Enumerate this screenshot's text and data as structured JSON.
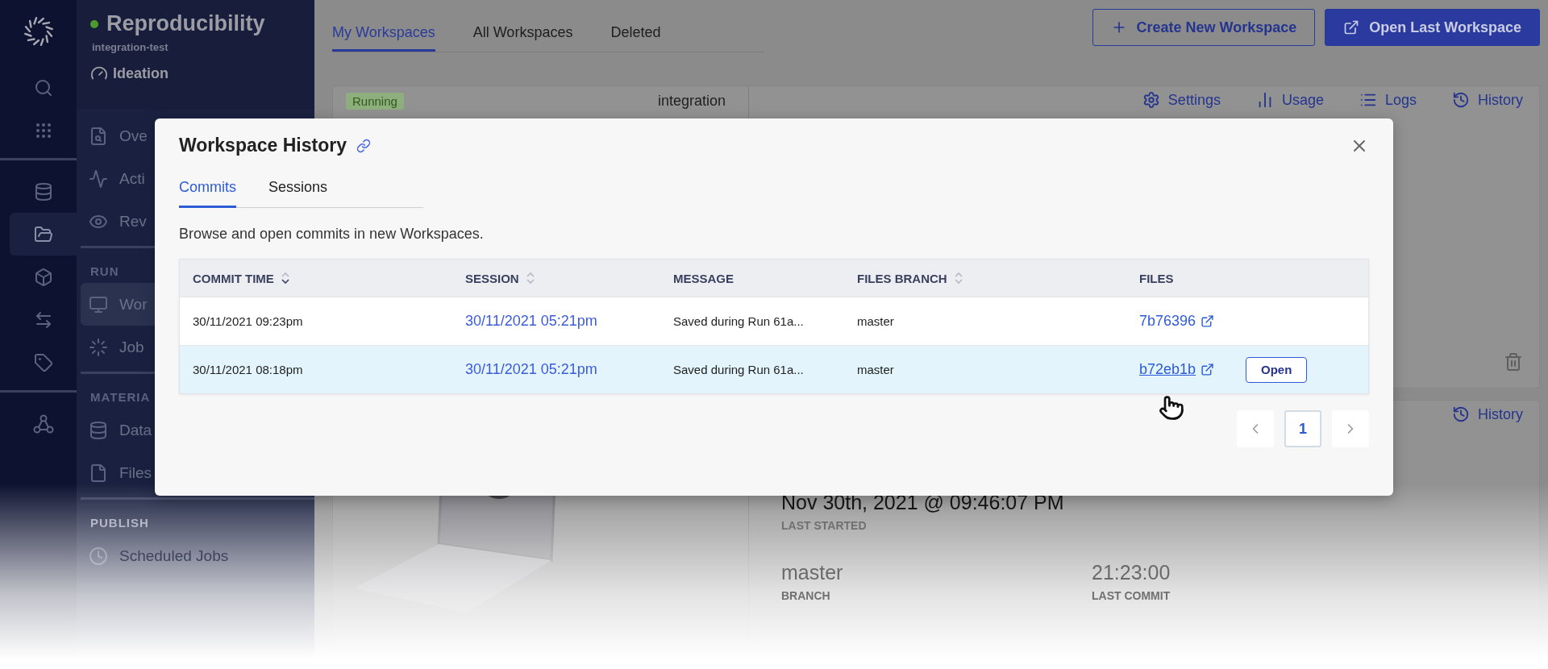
{
  "rail": {
    "groups": [
      [
        {
          "kind": "search",
          "selected": false
        },
        {
          "kind": "apps",
          "selected": false
        }
      ],
      [
        {
          "kind": "data",
          "selected": false
        },
        {
          "kind": "folder",
          "selected": true
        },
        {
          "kind": "cube",
          "selected": false
        },
        {
          "kind": "transfer",
          "selected": false
        },
        {
          "kind": "tag",
          "selected": false
        }
      ],
      [
        {
          "kind": "network",
          "selected": false
        }
      ]
    ]
  },
  "project": {
    "name": "Reproducibility",
    "owner": "integration-test",
    "stage": "Ideation"
  },
  "nav": {
    "sections": [
      {
        "items": [
          {
            "kind": "overview",
            "label": "Ove",
            "selected": false
          },
          {
            "kind": "activity",
            "label": "Acti",
            "selected": false
          },
          {
            "kind": "review",
            "label": "Rev",
            "selected": false
          }
        ]
      },
      {
        "heading": "RUN",
        "items": [
          {
            "kind": "workspaces",
            "label": "Wor",
            "selected": true
          },
          {
            "kind": "jobs",
            "label": "Job",
            "selected": false
          }
        ]
      },
      {
        "heading": "MATERIA",
        "items": [
          {
            "kind": "data",
            "label": "Data",
            "selected": false
          },
          {
            "kind": "files",
            "label": "Files",
            "selected": false
          }
        ]
      },
      {
        "heading": "PUBLISH",
        "items": [
          {
            "kind": "scheduled",
            "label": "Scheduled Jobs",
            "selected": false
          }
        ]
      }
    ]
  },
  "main": {
    "tabs": [
      {
        "label": "My Workspaces",
        "selected": true
      },
      {
        "label": "All Workspaces",
        "selected": false
      },
      {
        "label": "Deleted",
        "selected": false
      }
    ],
    "actions": [
      {
        "kind": "create",
        "label": "Create New Workspace"
      },
      {
        "kind": "open",
        "label": "Open Last Workspace"
      }
    ]
  },
  "workspaces": [
    {
      "status": "Running",
      "name": "integration",
      "actions": [
        {
          "kind": "settings",
          "label": "Settings"
        },
        {
          "kind": "usage",
          "label": "Usage"
        },
        {
          "kind": "logs",
          "label": "Logs"
        },
        {
          "kind": "history",
          "label": "History"
        }
      ]
    },
    {
      "actions": [
        {
          "kind": "history",
          "label": "History"
        }
      ],
      "started": "Nov 30th, 2021 @ 09:46:07 PM",
      "started_label": "LAST STARTED",
      "stats": [
        {
          "value": "master",
          "label": "BRANCH"
        },
        {
          "value": "21:23:00",
          "label": "LAST COMMIT"
        }
      ]
    }
  ],
  "modal": {
    "title": "Workspace History",
    "tabs": [
      {
        "label": "Commits",
        "selected": true
      },
      {
        "label": "Sessions",
        "selected": false
      }
    ],
    "description": "Browse and open commits in new Workspaces.",
    "columns": [
      {
        "label": "COMMIT TIME",
        "sortable": true,
        "sorted": true
      },
      {
        "label": "SESSION",
        "sortable": true,
        "sorted": false
      },
      {
        "label": "MESSAGE"
      },
      {
        "label": "FILES BRANCH",
        "sortable": true,
        "sorted": false
      },
      {
        "label": "FILES"
      }
    ],
    "rows": [
      {
        "commit_time": "30/11/2021 09:23pm",
        "session": "30/11/2021 05:21pm",
        "message": "Saved during Run 61a...",
        "branch": "master",
        "files": "7b76396",
        "hovered": false
      },
      {
        "commit_time": "30/11/2021 08:18pm",
        "session": "30/11/2021 05:21pm",
        "message": "Saved during Run 61a...",
        "branch": "master",
        "files": "b72eb1b",
        "hovered": true,
        "action": "Open"
      }
    ],
    "pages": [
      {
        "label": "1",
        "selected": true
      }
    ]
  }
}
